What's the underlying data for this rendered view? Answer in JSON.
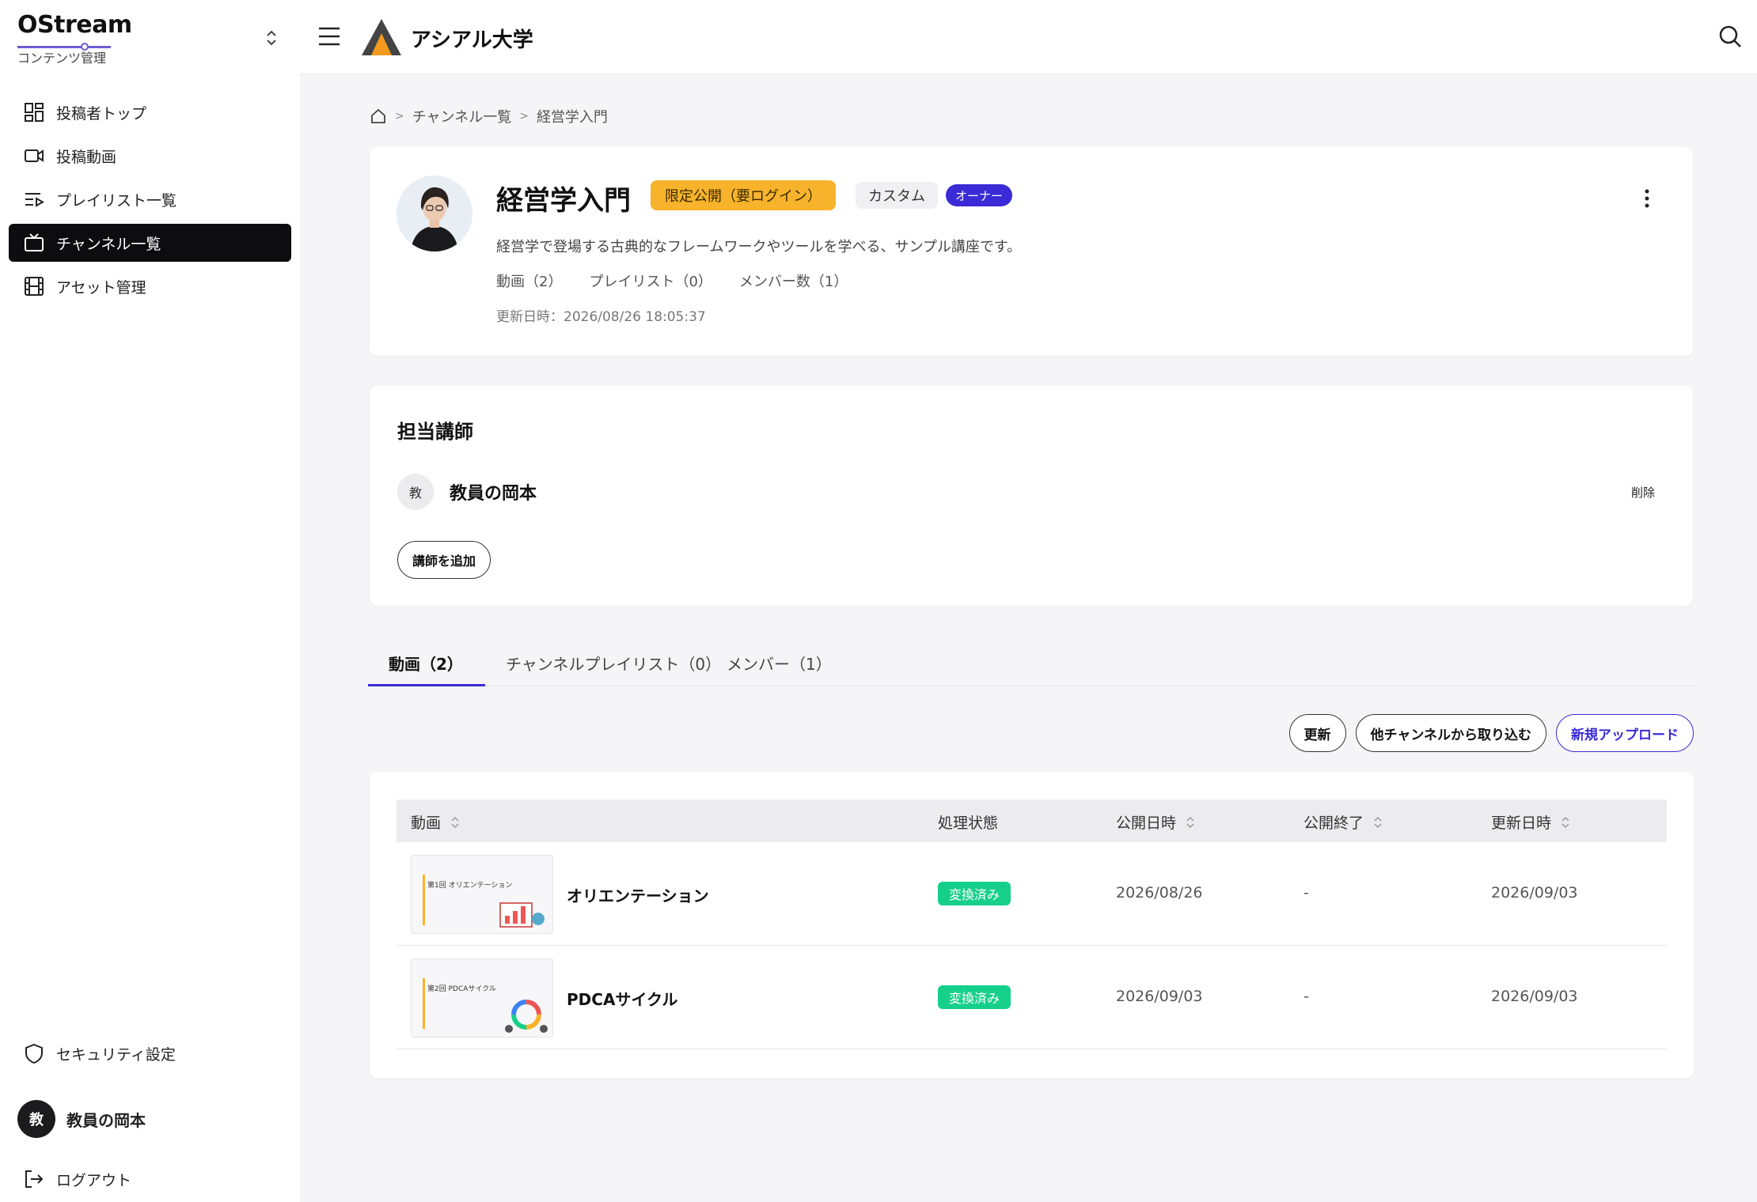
{
  "sidebar": {
    "logo": "OStream",
    "subtitle": "コンテンツ管理",
    "items": [
      {
        "label": "投稿者トップ"
      },
      {
        "label": "投稿動画"
      },
      {
        "label": "プレイリスト一覧"
      },
      {
        "label": "チャンネル一覧"
      },
      {
        "label": "アセット管理"
      }
    ],
    "security": "セキュリティ設定",
    "user_initial": "教",
    "user_name": "教員の岡本",
    "logout": "ログアウト"
  },
  "header": {
    "brand": "アシアル大学"
  },
  "breadcrumb": {
    "items": [
      "チャンネル一覧",
      "経営学入門"
    ]
  },
  "channel": {
    "title": "経営学入門",
    "visibility_badge": "限定公開（要ログイン）",
    "type_badge": "カスタム",
    "role_badge": "オーナー",
    "description": "経営学で登場する古典的なフレームワークやツールを学べる、サンプル講座です。",
    "stats": {
      "videos": "動画（2）",
      "playlists": "プレイリスト（0）",
      "members": "メンバー数（1）"
    },
    "updated": "更新日時：2026/08/26 18:05:37"
  },
  "instructors": {
    "title": "担当講師",
    "list": [
      {
        "initial": "教",
        "name": "教員の岡本",
        "delete": "削除"
      }
    ],
    "add_button": "講師を追加"
  },
  "tabs": [
    {
      "label": "動画（2）"
    },
    {
      "label": "チャンネルプレイリスト（0）"
    },
    {
      "label": "メンバー（1）"
    }
  ],
  "actions": {
    "refresh": "更新",
    "import": "他チャンネルから取り込む",
    "upload": "新規アップロード"
  },
  "table": {
    "headers": {
      "video": "動画",
      "status": "処理状態",
      "published": "公開日時",
      "ended": "公開終了",
      "updated": "更新日時"
    },
    "rows": [
      {
        "title": "オリエンテーション",
        "thumb_title": "第1回 オリエンテーション",
        "status": "変換済み",
        "published": "2026/08/26",
        "ended": "-",
        "updated": "2026/09/03"
      },
      {
        "title": "PDCAサイクル",
        "thumb_title": "第2回 PDCAサイクル",
        "status": "変換済み",
        "published": "2026/09/03",
        "ended": "-",
        "updated": "2026/09/03"
      }
    ]
  },
  "colors": {
    "accent": "#3a2bd6",
    "warning": "#f7b32b",
    "success": "#16d08a",
    "nav_active_bg": "#0d0d0f"
  }
}
